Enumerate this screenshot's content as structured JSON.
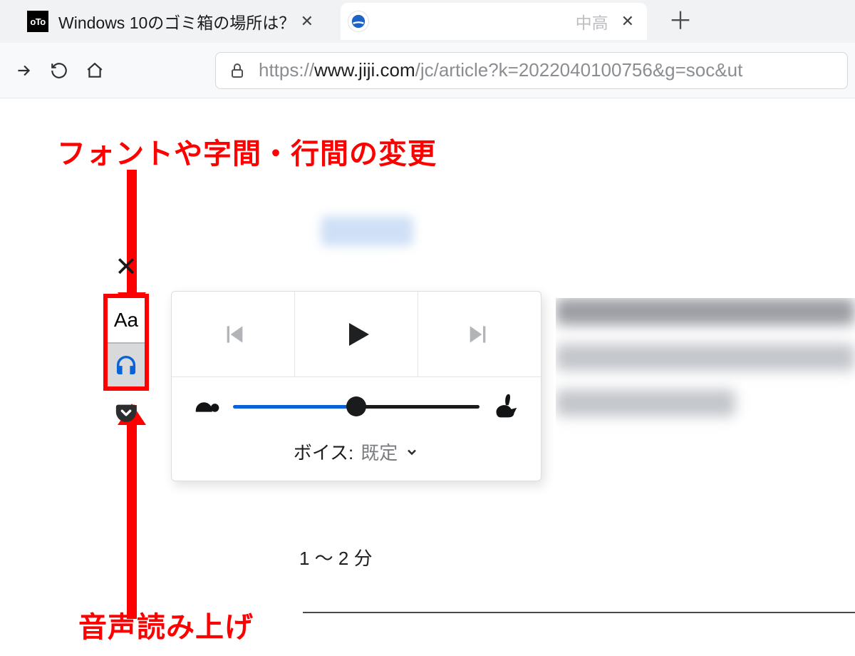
{
  "tabs": {
    "left": {
      "title": "Windows 10のゴミ箱の場所は？"
    },
    "right": {
      "title_fade": "中高"
    }
  },
  "url": {
    "prefix": "https://",
    "host": "www.jiji.com",
    "path": "/jc/article?k=2022040100756&g=soc&ut"
  },
  "annotations": {
    "font_and_spacing": "フォントや字間・行間の変更",
    "read_aloud": "音声読み上げ"
  },
  "reader": {
    "text_button_label": "Aa"
  },
  "playback": {
    "voice_label": "ボイス:",
    "voice_value": "既定",
    "speed_percent": 50,
    "estimate": "1 ～ 2 分"
  },
  "icons": {
    "tab_left_favicon": "oTo",
    "close_glyph": "✕",
    "plus_glyph": "＋",
    "reader_close_glyph": "✕"
  }
}
